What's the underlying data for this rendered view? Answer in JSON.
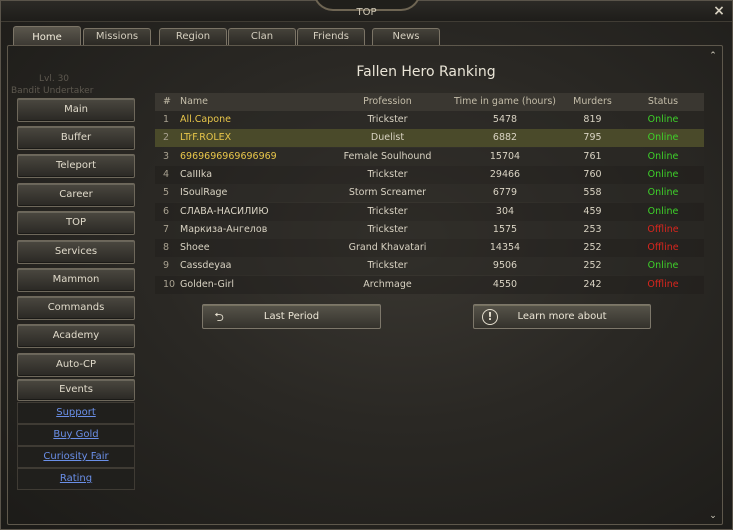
{
  "window": {
    "title": "TOP"
  },
  "tabs": [
    {
      "label": "Home"
    },
    {
      "label": "Missions"
    },
    {
      "label": "Region"
    },
    {
      "label": "Clan"
    },
    {
      "label": "Friends"
    },
    {
      "label": "News"
    }
  ],
  "background_text": [
    "Lvl. 30",
    "Bandit Undertaker"
  ],
  "sidebar": {
    "buttons": [
      {
        "label": "Main"
      },
      {
        "label": "Buffer"
      },
      {
        "label": "Teleport"
      },
      {
        "label": "Career"
      },
      {
        "label": "TOP"
      },
      {
        "label": "Services"
      },
      {
        "label": "Mammon"
      },
      {
        "label": "Commands"
      },
      {
        "label": "Academy"
      },
      {
        "label": "Auto-CP"
      },
      {
        "label": "Events"
      }
    ],
    "links": [
      {
        "label": "Support"
      },
      {
        "label": "Buy Gold"
      },
      {
        "label": "Curiosity Fair"
      },
      {
        "label": "Rating"
      }
    ]
  },
  "ranking": {
    "title": "Fallen Hero Ranking",
    "columns": {
      "num": "#",
      "name": "Name",
      "profession": "Profession",
      "time": "Time in game (hours)",
      "murders": "Murders",
      "status": "Status"
    },
    "rows": [
      {
        "num": "1",
        "name": "All.Capone",
        "profession": "Trickster",
        "time": "5478",
        "murders": "819",
        "status": "Online"
      },
      {
        "num": "2",
        "name": "LTrF.ROLEX",
        "profession": "Duelist",
        "time": "6882",
        "murders": "795",
        "status": "Online"
      },
      {
        "num": "3",
        "name": "6969696969696969",
        "profession": "Female Soulhound",
        "time": "15704",
        "murders": "761",
        "status": "Online"
      },
      {
        "num": "4",
        "name": "CaIIIka",
        "profession": "Trickster",
        "time": "29466",
        "murders": "760",
        "status": "Online"
      },
      {
        "num": "5",
        "name": "ISoulRage",
        "profession": "Storm Screamer",
        "time": "6779",
        "murders": "558",
        "status": "Online"
      },
      {
        "num": "6",
        "name": "СЛАВА-НАСИЛИЮ",
        "profession": "Trickster",
        "time": "304",
        "murders": "459",
        "status": "Online"
      },
      {
        "num": "7",
        "name": "Маркиза-Ангелов",
        "profession": "Trickster",
        "time": "1575",
        "murders": "253",
        "status": "Offline"
      },
      {
        "num": "8",
        "name": "Shoee",
        "profession": "Grand Khavatari",
        "time": "14354",
        "murders": "252",
        "status": "Offline"
      },
      {
        "num": "9",
        "name": "Cassdeyaa",
        "profession": "Trickster",
        "time": "9506",
        "murders": "252",
        "status": "Online"
      },
      {
        "num": "10",
        "name": "Golden-Girl",
        "profession": "Archmage",
        "time": "4550",
        "murders": "242",
        "status": "Offline"
      }
    ]
  },
  "actions": {
    "last_period": "Last Period",
    "learn_more": "Learn more about"
  },
  "colors": {
    "online": "#3ed12a",
    "offline": "#d8261e",
    "clan_name": "#e8c64a",
    "link": "#6a8fe8"
  }
}
